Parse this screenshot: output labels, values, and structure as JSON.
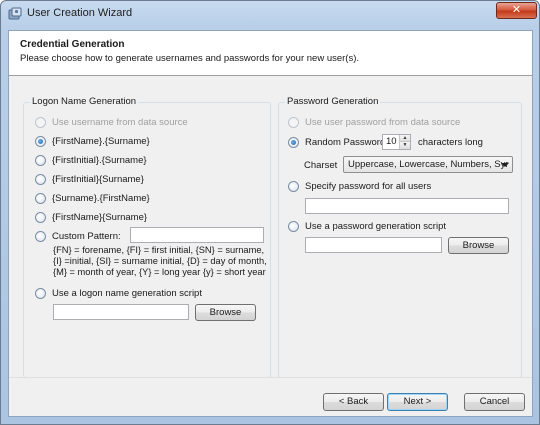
{
  "window": {
    "title": "User Creation Wizard",
    "close_glyph": "✕"
  },
  "header": {
    "title": "Credential Generation",
    "subtitle": "Please choose how to generate usernames and passwords for your new user(s)."
  },
  "logon": {
    "group_title": "Logon Name Generation",
    "options": [
      "Use username from data source",
      "{FirstName}.{Surname}",
      "{FirstInitial}.{Surname}",
      "{FirstInitial}{Surname}",
      "{Surname}.{FirstName}",
      "{FirstName}{Surname}"
    ],
    "custom_label": "Custom Pattern:",
    "custom_value": "",
    "hint_lines": [
      "{FN} = forename, {FI} = first initial, {SN} = surname,",
      "{I} =initial, {SI} = surname initial, {D} = day of month,",
      "{M} = month of year, {Y} = long year {y} = short year"
    ],
    "script_label": "Use a logon name generation script",
    "script_value": "",
    "browse_label": "Browse"
  },
  "password": {
    "group_title": "Password Generation",
    "use_source_label": "Use user password from data source",
    "random_label": "Random Password",
    "random_length": "10",
    "chars_label": "characters long",
    "charset_label": "Charset",
    "charset_value": "Uppercase, Lowercase, Numbers, Syr",
    "specify_label": "Specify password for all users",
    "specify_value": "",
    "script_label": "Use a password generation script",
    "script_value": "",
    "browse_label": "Browse"
  },
  "footer": {
    "back_label": "< Back",
    "next_label": "Next >",
    "cancel_label": "Cancel"
  }
}
